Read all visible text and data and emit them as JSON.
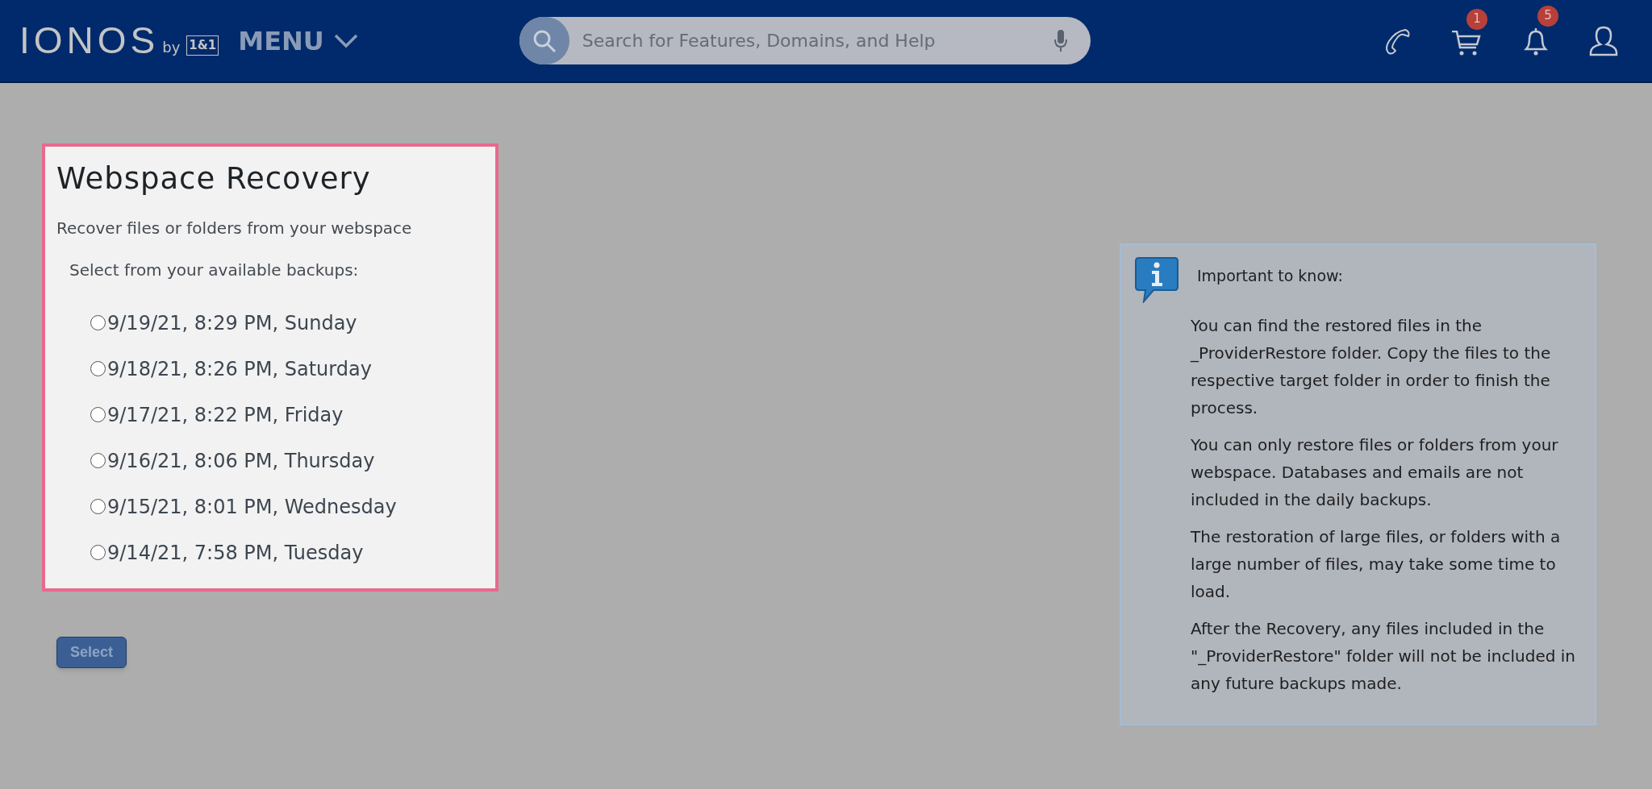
{
  "header": {
    "logo": "IONOS",
    "logo_by": "by",
    "logo_badge": "1&1",
    "menu": "MENU",
    "search": {
      "placeholder": "Search for Features, Domains, and Help"
    },
    "cart_count": "1",
    "notifications_count": "5"
  },
  "recovery": {
    "title": "Webspace Recovery",
    "subtitle": "Recover files or folders from your webspace",
    "prompt": "Select from your available backups:",
    "backups": [
      {
        "label": "9/19/21, 8:29 PM, Sunday",
        "selected": false
      },
      {
        "label": "9/18/21, 8:26 PM, Saturday",
        "selected": false
      },
      {
        "label": "9/17/21, 8:22 PM, Friday",
        "selected": false
      },
      {
        "label": "9/16/21, 8:06 PM, Thursday",
        "selected": false
      },
      {
        "label": "9/15/21, 8:01 PM, Wednesday",
        "selected": false
      },
      {
        "label": "9/14/21, 7:58 PM, Tuesday",
        "selected": false
      }
    ]
  },
  "select_button": {
    "label": "Select",
    "disabled": true
  },
  "info": {
    "title": "Important to know:",
    "paragraphs": [
      "You can find the restored files in the _ProviderRestore folder. Copy the files to the respective target folder in order to finish the process.",
      "You can only restore files or folders from your webspace. Databases and emails are not included in the daily backups.",
      "The restoration of large files, or folders with a large number of files, may take some time to load.",
      "After the Recovery, any files included in the \"_ProviderRestore\" folder will not be included in any future backups made."
    ]
  }
}
